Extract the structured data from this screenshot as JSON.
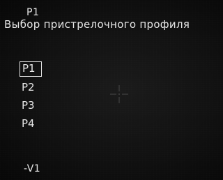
{
  "header": {
    "active_profile": "P1",
    "title": "Выбор пристрелочного профиля"
  },
  "profiles": [
    {
      "label": "P1",
      "selected": true
    },
    {
      "label": "P2",
      "selected": false
    },
    {
      "label": "P3",
      "selected": false
    },
    {
      "label": "P4",
      "selected": false
    }
  ],
  "footer": {
    "version": "-V1"
  },
  "colors": {
    "text": "#e6e6e6",
    "background": "#111111"
  },
  "icons": {
    "reticle": "crosshair-icon"
  }
}
